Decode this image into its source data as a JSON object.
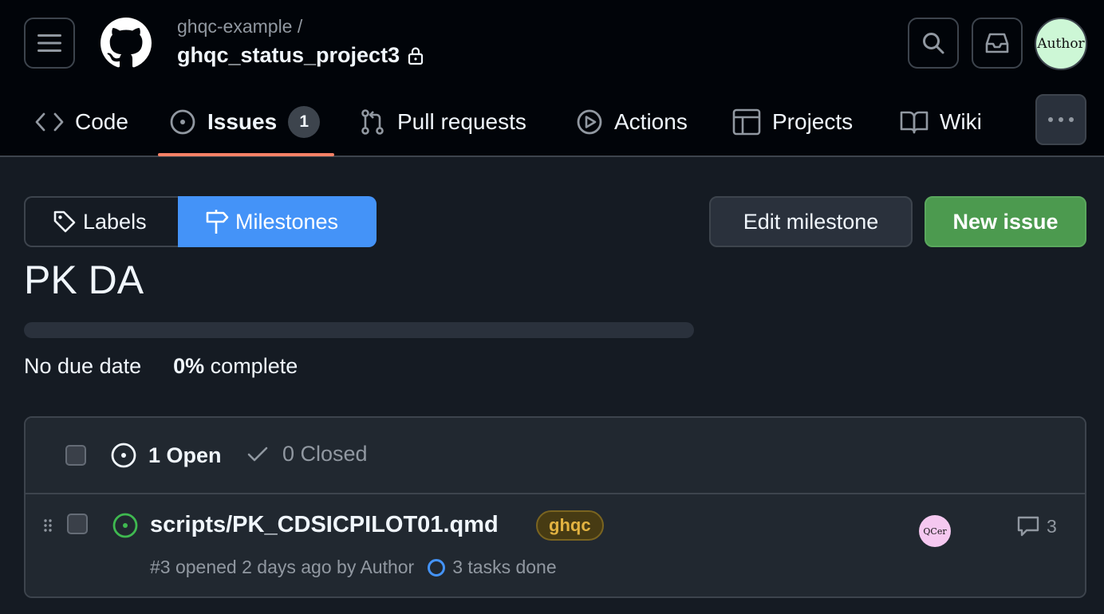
{
  "header": {
    "owner": "ghqc-example /",
    "repo": "ghqc_status_project3",
    "avatar_text": "Author"
  },
  "tabs": [
    {
      "label": "Code",
      "icon": "code-icon"
    },
    {
      "label": "Issues",
      "icon": "issue-opened-icon",
      "count": "1",
      "selected": true
    },
    {
      "label": "Pull requests",
      "icon": "git-pull-request-icon"
    },
    {
      "label": "Actions",
      "icon": "play-icon"
    },
    {
      "label": "Projects",
      "icon": "table-icon"
    },
    {
      "label": "Wiki",
      "icon": "book-icon"
    }
  ],
  "subnav": {
    "labels": "Labels",
    "milestones": "Milestones"
  },
  "buttons": {
    "edit_milestone": "Edit milestone",
    "new_issue": "New issue"
  },
  "milestone": {
    "title": "PK DA",
    "due": "No due date",
    "percent": "0%",
    "complete_label": "complete",
    "progress_fraction": 0
  },
  "list": {
    "open_label": "1 Open",
    "closed_label": "0 Closed",
    "issues": [
      {
        "title": "scripts/PK_CDSICPILOT01.qmd",
        "label": "ghqc",
        "meta": "#3 opened 2 days ago by Author",
        "tasks": "3 tasks done",
        "assignee": "QCer",
        "comments": "3"
      }
    ]
  },
  "colors": {
    "header_bg": "#010409",
    "page_bg": "#151b23",
    "accent_blue": "#4493f8",
    "accent_green": "#4c9a4f",
    "tab_underline": "#f78166",
    "open_icon": "#3fb950",
    "label_text": "#e3b341"
  }
}
